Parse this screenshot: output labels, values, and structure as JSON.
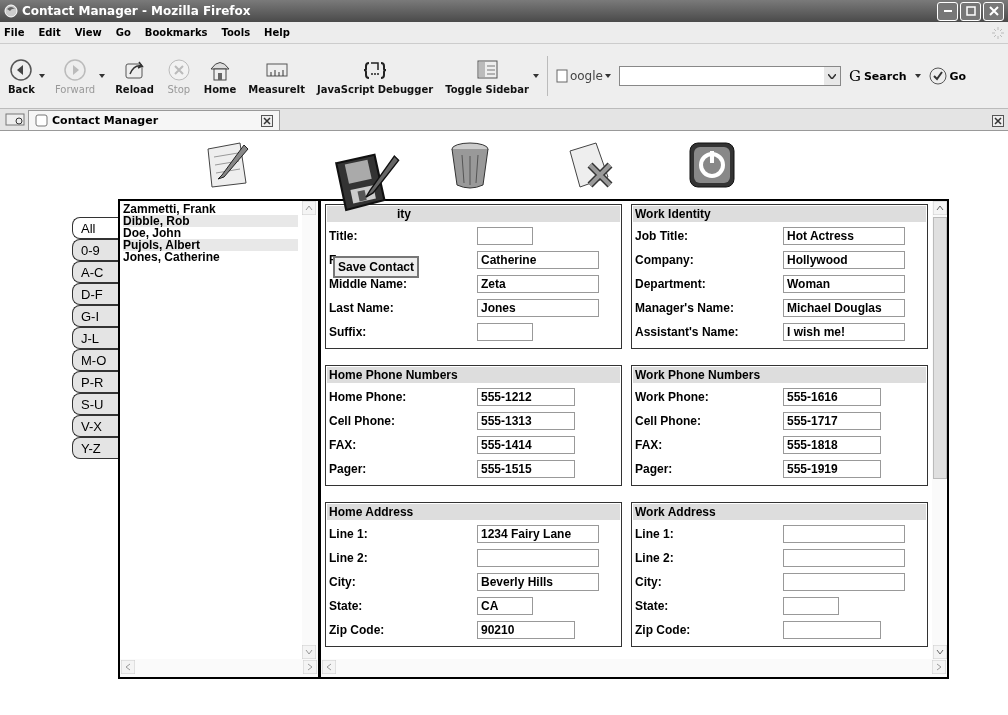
{
  "window": {
    "title": "Contact Manager - Mozilla Firefox"
  },
  "menu": [
    "File",
    "Edit",
    "View",
    "Go",
    "Bookmarks",
    "Tools",
    "Help"
  ],
  "toolbar": [
    {
      "label": "Back",
      "disabled": false,
      "dropdown": true
    },
    {
      "label": "Forward",
      "disabled": true,
      "dropdown": true
    },
    {
      "label": "Reload",
      "disabled": false,
      "dropdown": false
    },
    {
      "label": "Stop",
      "disabled": true,
      "dropdown": false
    },
    {
      "label": "Home",
      "disabled": false,
      "dropdown": false
    },
    {
      "label": "MeasureIt",
      "disabled": false,
      "dropdown": false
    },
    {
      "label": "JavaScript Debugger",
      "disabled": false,
      "dropdown": false
    },
    {
      "label": "Toggle Sidebar",
      "disabled": false,
      "dropdown": true
    }
  ],
  "search": {
    "engine": "oogle",
    "logo": "G",
    "button": "Search",
    "go": "Go"
  },
  "tabs": [
    {
      "label": "Contact Manager",
      "selected": true
    }
  ],
  "app": {
    "drag_tooltip": "Save Contact",
    "letter_tabs": [
      {
        "label": "All",
        "selected": true
      },
      {
        "label": "0-9",
        "selected": false
      },
      {
        "label": "A-C",
        "selected": false
      },
      {
        "label": "D-F",
        "selected": false
      },
      {
        "label": "G-I",
        "selected": false
      },
      {
        "label": "J-L",
        "selected": false
      },
      {
        "label": "M-O",
        "selected": false
      },
      {
        "label": "P-R",
        "selected": false
      },
      {
        "label": "S-U",
        "selected": false
      },
      {
        "label": "V-X",
        "selected": false
      },
      {
        "label": "Y-Z",
        "selected": false
      }
    ],
    "contacts": [
      {
        "name": "Zammetti, Frank",
        "highlighted": false
      },
      {
        "name": "Dibble, Rob",
        "highlighted": true
      },
      {
        "name": "Doe, John",
        "highlighted": false
      },
      {
        "name": "Pujols, Albert",
        "highlighted": true
      },
      {
        "name": "Jones, Catherine",
        "highlighted": false
      }
    ],
    "sections": [
      {
        "title": "ity",
        "fields": [
          {
            "label": "Title:",
            "kind": "short"
          },
          {
            "label": "F",
            "value": "Catherine",
            "kind": "long"
          },
          {
            "label": "Middle Name:",
            "value": "Zeta",
            "kind": "long"
          },
          {
            "label": "Last Name:",
            "value": "Jones",
            "kind": "long"
          },
          {
            "label": "Suffix:",
            "kind": "short"
          }
        ]
      },
      {
        "title": "Work Identity",
        "fields": [
          {
            "label": "Job Title:",
            "value": "Hot Actress",
            "kind": "long"
          },
          {
            "label": "Company:",
            "value": "Hollywood",
            "kind": "long"
          },
          {
            "label": "Department:",
            "value": "Woman",
            "kind": "long"
          },
          {
            "label": "Manager's Name:",
            "value": "Michael Douglas",
            "kind": "long"
          },
          {
            "label": "Assistant's Name:",
            "value": "I wish me!",
            "kind": "long"
          }
        ]
      },
      {
        "title": "Home Phone Numbers",
        "fields": [
          {
            "label": "Home Phone:",
            "value": "555-1212",
            "kind": "medium"
          },
          {
            "label": "Cell Phone:",
            "value": "555-1313",
            "kind": "medium"
          },
          {
            "label": "FAX:",
            "value": "555-1414",
            "kind": "medium"
          },
          {
            "label": "Pager:",
            "value": "555-1515",
            "kind": "medium"
          }
        ]
      },
      {
        "title": "Work Phone Numbers",
        "fields": [
          {
            "label": "Work Phone:",
            "value": "555-1616",
            "kind": "medium"
          },
          {
            "label": "Cell Phone:",
            "value": "555-1717",
            "kind": "medium"
          },
          {
            "label": "FAX:",
            "value": "555-1818",
            "kind": "medium"
          },
          {
            "label": "Pager:",
            "value": "555-1919",
            "kind": "medium"
          }
        ]
      },
      {
        "title": "Home Address",
        "fields": [
          {
            "label": "Line 1:",
            "value": "1234 Fairy Lane",
            "kind": "long"
          },
          {
            "label": "Line 2:",
            "kind": "long"
          },
          {
            "label": "City:",
            "value": "Beverly Hills",
            "kind": "long"
          },
          {
            "label": "State:",
            "value": "CA",
            "kind": "short"
          },
          {
            "label": "Zip Code:",
            "value": "90210",
            "kind": "medium"
          }
        ]
      },
      {
        "title": "Work Address",
        "fields": [
          {
            "label": "Line 1:",
            "kind": "long"
          },
          {
            "label": "Line 2:",
            "kind": "long"
          },
          {
            "label": "City:",
            "kind": "long"
          },
          {
            "label": "State:",
            "kind": "short"
          },
          {
            "label": "Zip Code:",
            "kind": "medium"
          }
        ]
      }
    ]
  }
}
